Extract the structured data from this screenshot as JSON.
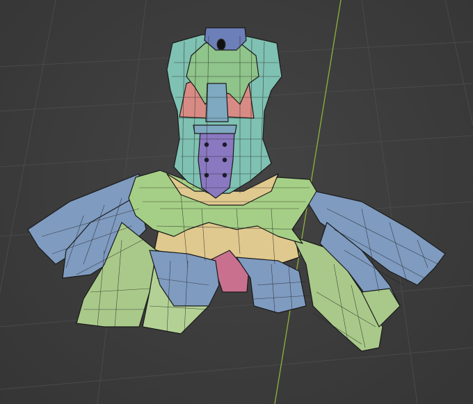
{
  "viewport": {
    "background": "#3a3a3a",
    "grid_color": "#4a4a4a",
    "y_axis_color": "#8fb33a"
  },
  "mesh": {
    "colors": {
      "bodice": "#7fc1b2",
      "collar": "#6d7fb8",
      "jabot_green": "#8fc48a",
      "jabot_pink": "#d88b84",
      "center_panel": "#8a78c0",
      "button": "#1b1b2a",
      "frill": "#a5cf86",
      "petticoat": "#e0c98e",
      "skirt_blue": "#7f9bc0",
      "skirt_green": "#a9c98a",
      "underlayer_pink": "#c9708e",
      "brooch": "#111111"
    }
  }
}
